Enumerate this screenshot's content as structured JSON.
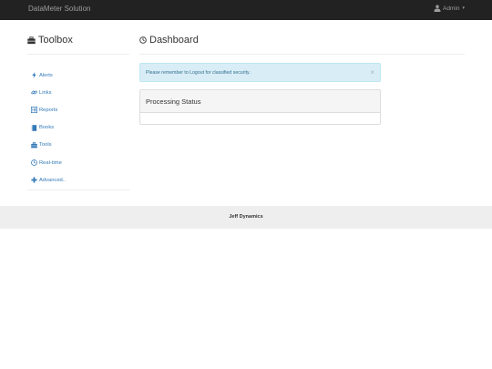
{
  "navbar": {
    "brand": "DataMeter Solution",
    "user_label": "Admin",
    "user_icon": "user-icon",
    "caret": "▾"
  },
  "sidebar": {
    "title": "Toolbox",
    "title_icon": "briefcase-icon",
    "items": [
      {
        "label": "Alerts",
        "icon": "flash-icon"
      },
      {
        "label": "Links",
        "icon": "link-icon"
      },
      {
        "label": "Reports",
        "icon": "list-alt-icon"
      },
      {
        "label": "Books",
        "icon": "book-icon"
      },
      {
        "label": "Tools",
        "icon": "briefcase-icon"
      },
      {
        "label": "Real-time",
        "icon": "clock-icon"
      },
      {
        "label": "Advanced..",
        "icon": "plus-icon"
      }
    ]
  },
  "main": {
    "title": "Dashboard",
    "title_icon": "dashboard-icon",
    "alert": {
      "text": "Please remember to Logout for classified security.",
      "close": "×"
    },
    "panel": {
      "title": "Processing Status"
    }
  },
  "footer": {
    "text": "Jeff Dynamics"
  },
  "colors": {
    "navbar_bg": "#222222",
    "link": "#337ab7",
    "alert_bg": "#d9edf7",
    "alert_text": "#31708f",
    "footer_bg": "#eeeeee"
  }
}
